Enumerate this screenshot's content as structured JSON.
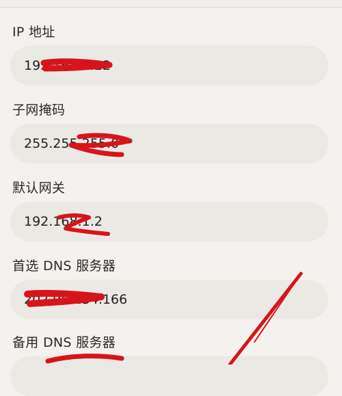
{
  "fields": [
    {
      "label": "IP 地址",
      "value": "192.168.1.22"
    },
    {
      "label": "子网掩码",
      "value": "255.255.255.0"
    },
    {
      "label": "默认网关",
      "value": "192.168.1.2"
    },
    {
      "label": "首选 DNS 服务器",
      "value": "202.96.134.166"
    },
    {
      "label": "备用 DNS 服务器",
      "value": ""
    }
  ],
  "colors": {
    "background": "#f4f2ee",
    "field_background": "#ebe9e4",
    "redaction": "#d8141b"
  }
}
